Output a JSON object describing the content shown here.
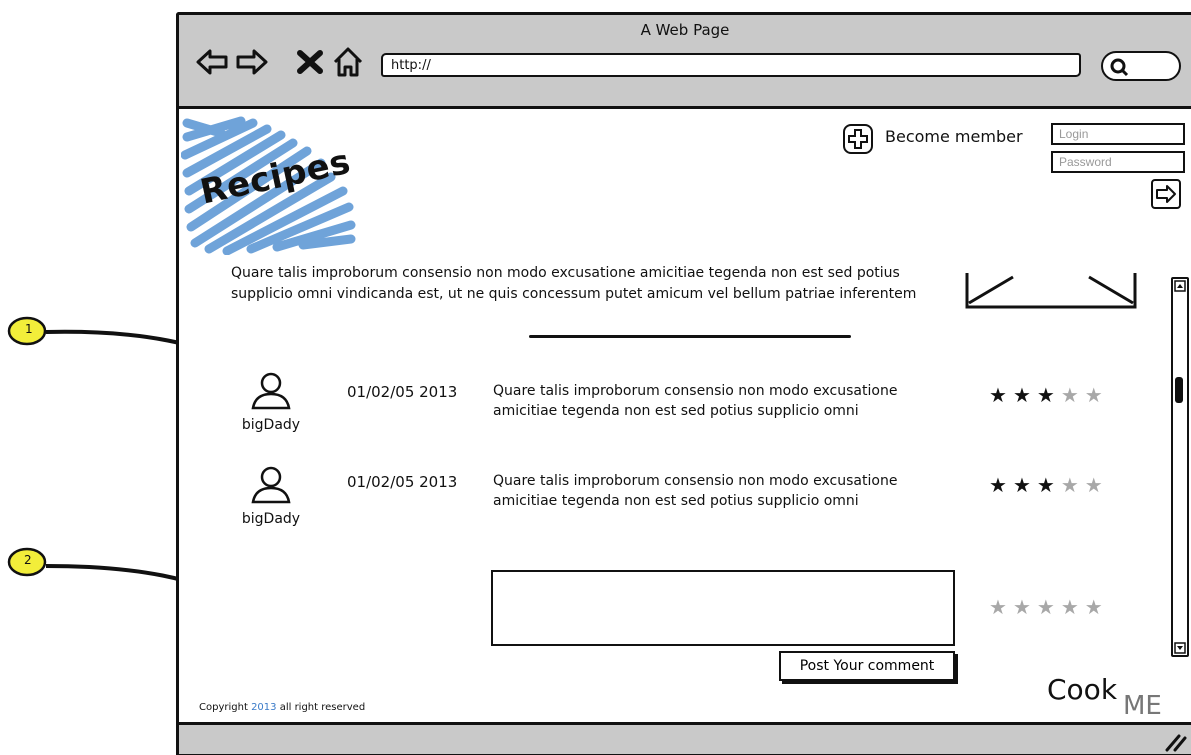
{
  "window": {
    "title": "A Web Page",
    "url": "http://"
  },
  "header": {
    "logo_text": "Recipes",
    "become_member": "Become member",
    "login_placeholder": "Login",
    "password_placeholder": "Password"
  },
  "intro": {
    "line1": "Quare talis improborum consensio non modo excusatione amicitiae tegenda non est sed potius",
    "line2": "supplicio omni vindicanda est, ut ne quis concessum putet amicum vel bellum patriae inferentem"
  },
  "comments": [
    {
      "user": "bigDady",
      "date": "01/02/05 2013",
      "line1": "Quare talis improborum consensio non modo excusatione",
      "line2": "amicitiae tegenda non est sed potius supplicio omni",
      "rating": 3,
      "rating_max": 5
    },
    {
      "user": "bigDady",
      "date": "01/02/05 2013",
      "line1": "Quare talis improborum consensio non modo excusatione",
      "line2": "amicitiae tegenda non est sed potius supplicio omni",
      "rating": 3,
      "rating_max": 5
    }
  ],
  "new_comment": {
    "value": "",
    "rating": 0,
    "rating_max": 5,
    "post_label": "Post Your comment"
  },
  "footer": {
    "copyright_pre": "Copyright",
    "copyright_year": "2013",
    "copyright_post": "all right reserved",
    "brand_cook": "Cook",
    "brand_me": "ME"
  },
  "annotations": {
    "marker1": "1",
    "marker2": "2"
  },
  "colors": {
    "logo_scribble": "#6fa3d9",
    "chrome": "#c9c9c9",
    "copyright_year": "#3b7bc8",
    "callout": "#f2ee3a"
  }
}
